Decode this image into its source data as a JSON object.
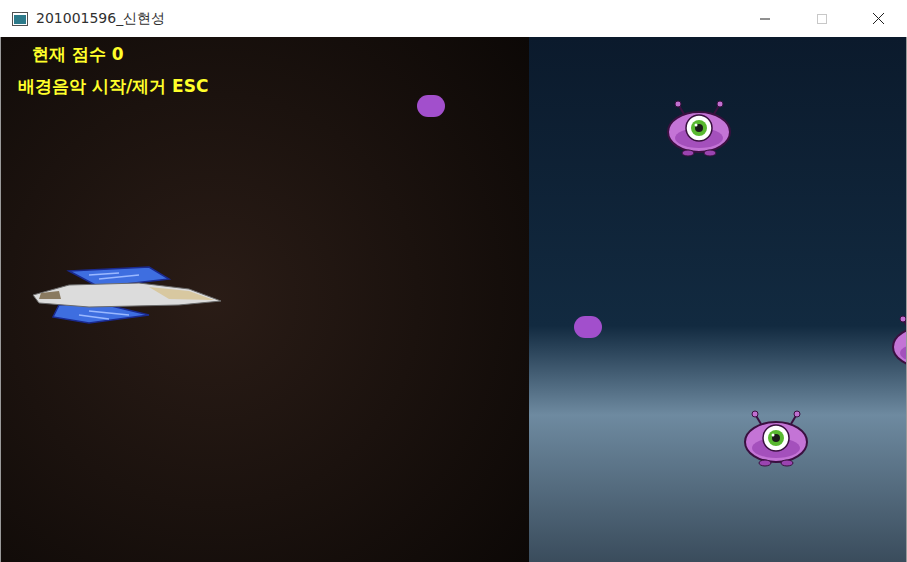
{
  "window": {
    "title": "201001596_신현성",
    "controls": [
      {
        "kind": "minimize",
        "disabled": false
      },
      {
        "kind": "maximize",
        "disabled": true
      },
      {
        "kind": "close",
        "disabled": false
      }
    ]
  },
  "hud": {
    "score": "현재 점수 0",
    "music_hint": "배경음악 시작/제거 ESC"
  }
}
